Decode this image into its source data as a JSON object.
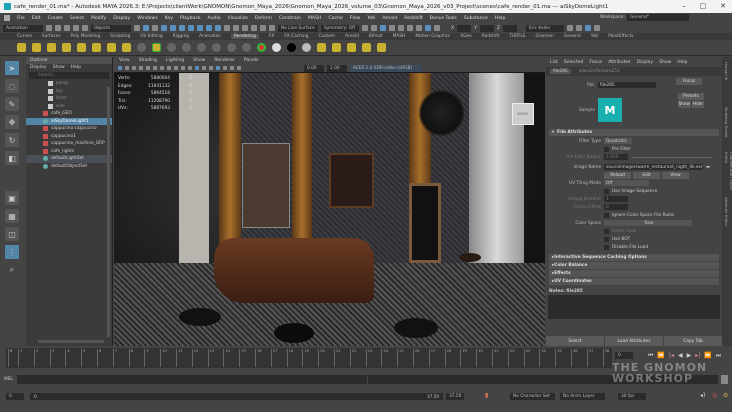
{
  "title": "cafe_render_01.ma* - Autodesk MAYA 2026.3: E:\\Projects\\clientWork\\GNOMON\\Gnomon_Maya_2026\\Gnomon_Maya_2026_volume_03\\Gnomon_Maya_2026_v03_Project\\scenes\\cafe_render_01.ma --- aiSkyDomeLight1",
  "menus": [
    "File",
    "Edit",
    "Create",
    "Select",
    "Modify",
    "Display",
    "Windows",
    "Key",
    "Playback",
    "Audio",
    "Visualize",
    "Deform",
    "Constrain",
    "MASH",
    "Cache",
    "Flow",
    "Yeti",
    "Arnold",
    "Redshift",
    "Bonus Tools",
    "Substance",
    "Help"
  ],
  "status": {
    "mode": "Animation",
    "objects": "Objects",
    "live": "No Live Surface",
    "symmetry": "Symmetry: Off",
    "x": "X",
    "y": "Y",
    "z": "Z",
    "user": "Eric Keller",
    "workspace_label": "Workspace:",
    "workspace": "General*"
  },
  "shelf_tabs": [
    "Curves",
    "Surfaces",
    "Poly Modeling",
    "Sculpting",
    "UV Editing",
    "Rigging",
    "Animation",
    "Rendering",
    "FX",
    "FX Caching",
    "Custom",
    "Arnold",
    "Bifrost",
    "MASH",
    "Motion Graphics",
    "XGen",
    "Redshift",
    "TURTLE",
    "Gnomon",
    "General",
    "Yeti",
    "PaintEffects"
  ],
  "shelf_active": "Rendering",
  "outliner": {
    "title": "Outliner",
    "menu": [
      "Display",
      "Show",
      "Help"
    ],
    "search": "Search...",
    "items": [
      {
        "label": "persp",
        "type": "cam"
      },
      {
        "label": "top",
        "type": "cam"
      },
      {
        "label": "front",
        "type": "cam"
      },
      {
        "label": "side",
        "type": "cam"
      },
      {
        "label": "cafe_GEO"
      },
      {
        "label": "aiSkyDomeLight1",
        "sel": true
      },
      {
        "label": "cappucino:cappucino"
      },
      {
        "label": "cappucino1"
      },
      {
        "label": "cappucino_machine_GRP"
      },
      {
        "label": "cafe_lights"
      },
      {
        "label": "defaultLightSet",
        "hl": true
      },
      {
        "label": "defaultObjectSet"
      }
    ]
  },
  "viewport": {
    "menu": [
      "View",
      "Shading",
      "Lighting",
      "Show",
      "Renderer",
      "Panels"
    ],
    "exposure": "0.00",
    "gamma": "1.00",
    "colorspace": "ACES 1.0 SDR-video (sRGB)",
    "view_cube": "RIGHT",
    "hud": [
      {
        "k": "Verts:",
        "v": "5880004",
        "s": "0"
      },
      {
        "k": "Edges:",
        "v": "11641132",
        "s": "0"
      },
      {
        "k": "Faces:",
        "v": "5864518",
        "s": "0"
      },
      {
        "k": "Tris:",
        "v": "11208790",
        "s": "0"
      },
      {
        "k": "UVs:",
        "v": "5887693",
        "s": "0"
      }
    ]
  },
  "ae": {
    "menu": [
      "List",
      "Selected",
      "Focus",
      "Attributes",
      "Display",
      "Show",
      "Help"
    ],
    "tabs": [
      "file285",
      "place2dTexture251"
    ],
    "file_label": "file:",
    "file_value": "file285",
    "focus": "Focus",
    "presets": "Presets",
    "show": "Show",
    "hide": "Hide",
    "sample": "Sample",
    "section": "File Attributes",
    "filter_type_label": "Filter Type",
    "filter_type": "Quadratic",
    "pre_filter": "Pre Filter",
    "pre_filter_radius_label": "Pre Filter Radius",
    "pre_filter_radius": "2.000",
    "image_name_label": "Image Name",
    "image_name": "sourceimages\\warm_restaurant_night_4k.exr",
    "reload": "Reload",
    "edit": "Edit",
    "view": "View",
    "uv_tiling_label": "UV Tiling Mode",
    "uv_tiling": "Off",
    "use_seq": "Use Image Sequence",
    "image_number_label": "Image Number",
    "image_number": "1",
    "frame_offset_label": "Frame Offset",
    "frame_offset": "0",
    "ignore_cs": "Ignore Color Space File Rules",
    "color_space_label": "Color Space",
    "color_space": "Raw",
    "invert": "Invert View",
    "use_bot": "Use BOT",
    "disable_load": "Disable File Load",
    "collapsed": [
      "Interactive Sequence Caching Options",
      "Color Balance",
      "Effects",
      "UV Coordinates"
    ],
    "notes": "Notes:  file285",
    "select": "Select",
    "load_attr": "Load Attributes",
    "copy_tab": "Copy Tab"
  },
  "side_tabs": [
    "Human IK",
    "Modeling Toolkit",
    "Channel Box / Layer Editor",
    "Attribute Editor"
  ],
  "timeline": {
    "ticks": [
      "1",
      "2",
      "3",
      "4",
      "5",
      "6",
      "7",
      "8",
      "9",
      "10",
      "11",
      "12",
      "13",
      "14",
      "15",
      "16",
      "17",
      "18",
      "19",
      "20",
      "21",
      "22",
      "23",
      "24",
      "25",
      "26",
      "27",
      "28",
      "29",
      "30",
      "31",
      "32",
      "33",
      "34",
      "35",
      "36",
      "37",
      "38"
    ],
    "current": "0",
    "current_field": "0"
  },
  "mel": "MEL",
  "range": {
    "start": "0",
    "inner_start": "0",
    "inner_end": "37.50",
    "end": "37.50",
    "char_set": "No Character Set",
    "anim_layer": "No Anim Layer",
    "fps": "30 fps"
  },
  "watermark": "THE GNOMON WORKSHOP"
}
